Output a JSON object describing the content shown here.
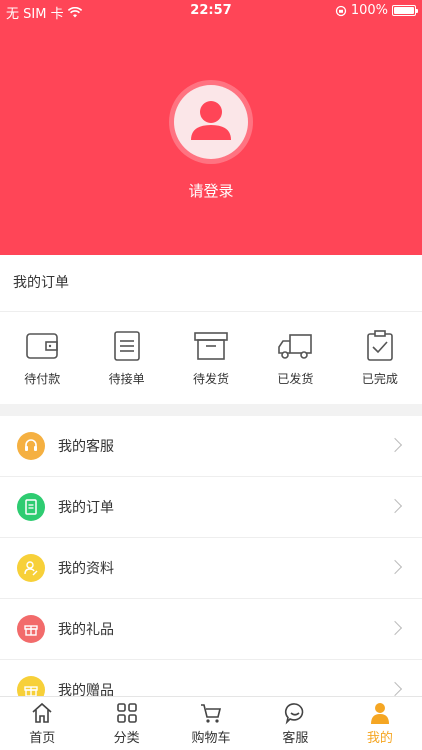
{
  "status_bar": {
    "carrier": "无 SIM 卡",
    "time": "22:57",
    "battery": "100%"
  },
  "profile": {
    "login_label": "请登录"
  },
  "orders": {
    "title": "我的订单",
    "items": [
      {
        "label": "待付款",
        "icon": "wallet-icon"
      },
      {
        "label": "待接单",
        "icon": "list-icon"
      },
      {
        "label": "待发货",
        "icon": "box-icon"
      },
      {
        "label": "已发货",
        "icon": "truck-icon"
      },
      {
        "label": "已完成",
        "icon": "clipboard-check-icon"
      }
    ]
  },
  "menu": {
    "items": [
      {
        "label": "我的客服",
        "icon": "headset-icon",
        "color": "#f5b041"
      },
      {
        "label": "我的订单",
        "icon": "document-icon",
        "color": "#2ecc71"
      },
      {
        "label": "我的资料",
        "icon": "user-edit-icon",
        "color": "#f7d039"
      },
      {
        "label": "我的礼品",
        "icon": "gift-icon",
        "color": "#f26b6b"
      },
      {
        "label": "我的赠品",
        "icon": "gift-box-icon",
        "color": "#f7d039"
      }
    ]
  },
  "tabbar": {
    "active": "我的",
    "accent": "#f5a623",
    "items": [
      {
        "label": "首页",
        "icon": "home-icon"
      },
      {
        "label": "分类",
        "icon": "grid-icon"
      },
      {
        "label": "购物车",
        "icon": "cart-icon"
      },
      {
        "label": "客服",
        "icon": "chat-icon"
      },
      {
        "label": "我的",
        "icon": "person-icon"
      }
    ]
  },
  "colors": {
    "header": "#ff4557",
    "accent": "#f5a623"
  }
}
